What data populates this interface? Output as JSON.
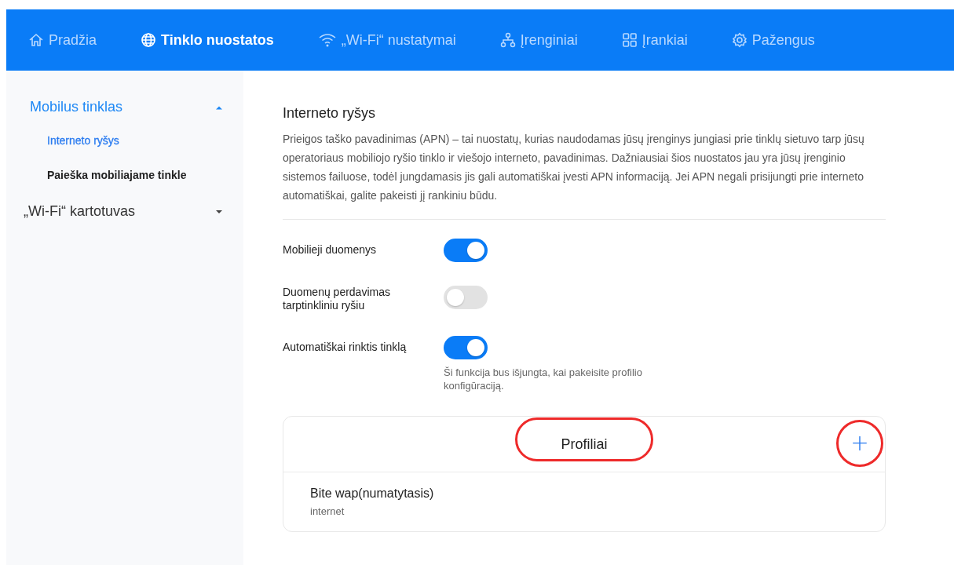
{
  "nav": [
    {
      "label": "Pradžia",
      "selected": false
    },
    {
      "label": "Tinklo nuostatos",
      "selected": true
    },
    {
      "label": "„Wi-Fi“ nustatymai",
      "selected": false
    },
    {
      "label": "Įrenginiai",
      "selected": false
    },
    {
      "label": "Įrankiai",
      "selected": false
    },
    {
      "label": "Pažengus",
      "selected": false
    }
  ],
  "sidebar": {
    "items": [
      {
        "label": "Mobilus tinklas",
        "selected": true,
        "expanded": true,
        "children": [
          {
            "label": "Interneto ryšys",
            "selected": true
          },
          {
            "label": "Paieška mobiliajame tinkle",
            "selected": false
          }
        ]
      },
      {
        "label": "„Wi-Fi“ kartotuvas",
        "selected": false,
        "expanded": false
      }
    ]
  },
  "section": {
    "title": "Interneto ryšys",
    "description": "Prieigos taško pavadinimas (APN) – tai nuostatų, kurias naudodamas jūsų įrenginys jungiasi prie tinklų sietuvo tarp jūsų operatoriaus mobiliojo ryšio tinklo ir viešojo interneto, pavadinimas. Dažniausiai šios nuostatos jau yra jūsų įrenginio sistemos failuose, todėl jungdamasis jis gali automatiškai įvesti APN informaciją. Jei APN negali prisijungti prie interneto automatiškai, galite pakeisti jį rankiniu būdu."
  },
  "settings": [
    {
      "label": "Mobilieji duomenys",
      "on": true
    },
    {
      "label": "Duomenų perdavimas tarptinkliniu ryšiu",
      "on": false
    },
    {
      "label": "Automatiškai rinktis tinklą",
      "on": true,
      "note": "Ši funkcija bus išjungta, kai pakeisite profilio konfigūraciją."
    }
  ],
  "profiles": {
    "title": "Profiliai",
    "title_highlighted": true,
    "add_button": {
      "label": "+",
      "highlighted": true
    },
    "items": [
      {
        "name": "Bite wap(numatytasis)",
        "apn": "internet"
      }
    ]
  }
}
